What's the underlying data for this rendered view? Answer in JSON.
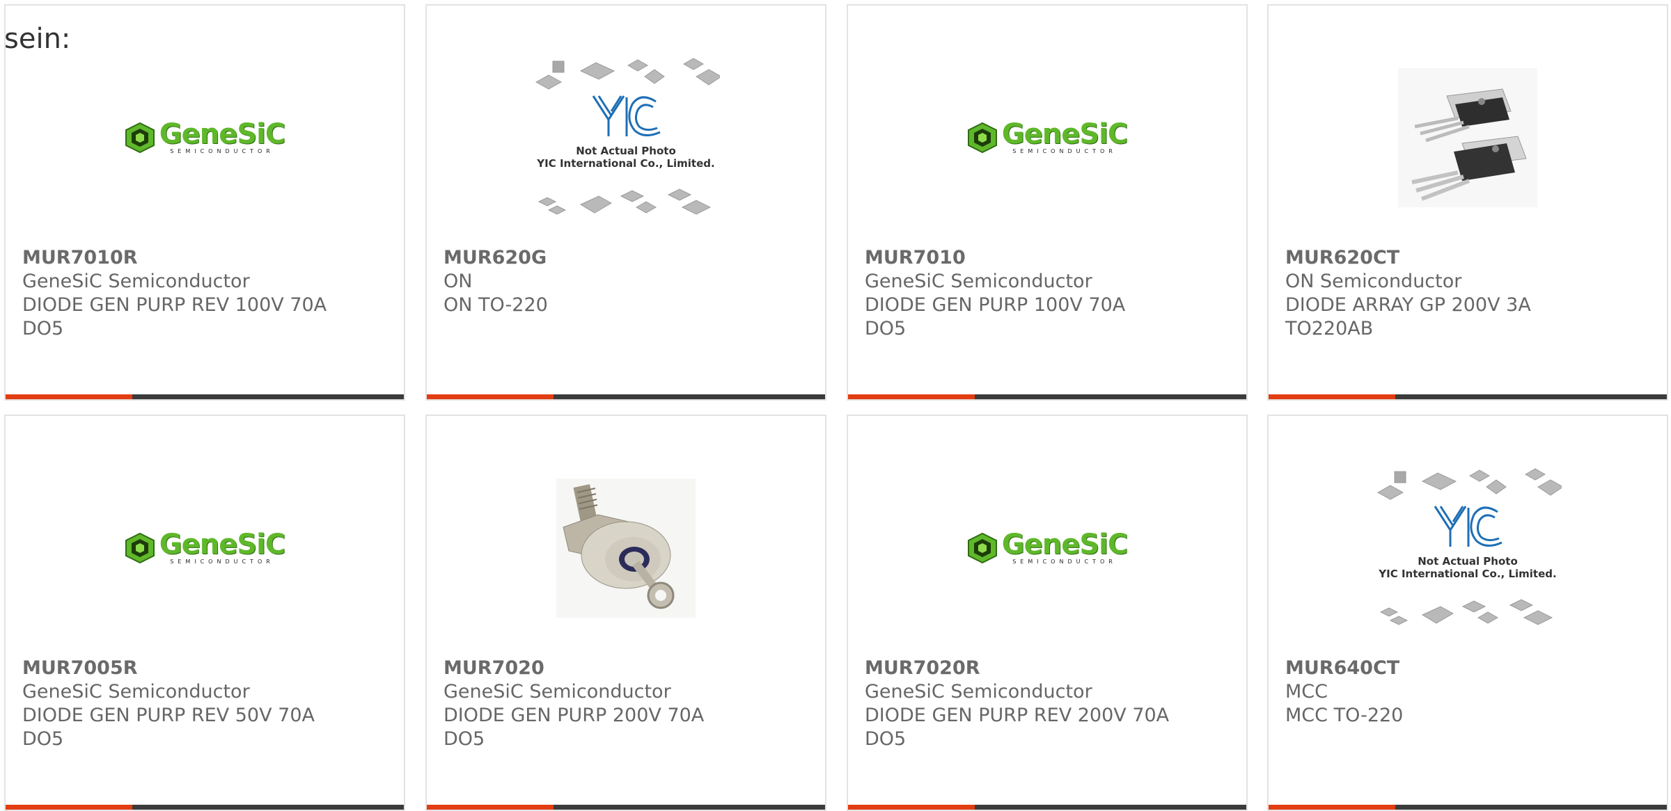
{
  "heading": "sein:",
  "colors": {
    "accent": "#e23d12",
    "bar": "#3b3b3b",
    "genesic_green": "#5fb82a"
  },
  "products": [
    {
      "part": "MUR7010R",
      "maker": "GeneSiC Semiconductor",
      "desc": "DIODE GEN PURP REV 100V 70A DO5",
      "image": "genesic-logo"
    },
    {
      "part": "MUR620G",
      "maker": "ON",
      "desc": "ON TO-220",
      "image": "yic-not-actual-photo"
    },
    {
      "part": "MUR7010",
      "maker": "GeneSiC Semiconductor",
      "desc": "DIODE GEN PURP 100V 70A DO5",
      "image": "genesic-logo"
    },
    {
      "part": "MUR620CT",
      "maker": "ON Semiconductor",
      "desc": "DIODE ARRAY GP 200V 3A TO220AB",
      "image": "to220-photo"
    },
    {
      "part": "MUR7005R",
      "maker": "GeneSiC Semiconductor",
      "desc": "DIODE GEN PURP REV 50V 70A DO5",
      "image": "genesic-logo"
    },
    {
      "part": "MUR7020",
      "maker": "GeneSiC Semiconductor",
      "desc": "DIODE GEN PURP 200V 70A DO5",
      "image": "do5-stud-photo"
    },
    {
      "part": "MUR7020R",
      "maker": "GeneSiC Semiconductor",
      "desc": "DIODE GEN PURP REV 200V 70A DO5",
      "image": "genesic-logo"
    },
    {
      "part": "MUR640CT",
      "maker": "MCC",
      "desc": "MCC TO-220",
      "image": "yic-not-actual-photo"
    }
  ],
  "logo_text": {
    "genesic_word": "GeneSiC",
    "genesic_sub": "SEMICONDUCTOR",
    "yic_line1": "Not Actual Photo",
    "yic_line2": "YIC International Co., Limited."
  }
}
